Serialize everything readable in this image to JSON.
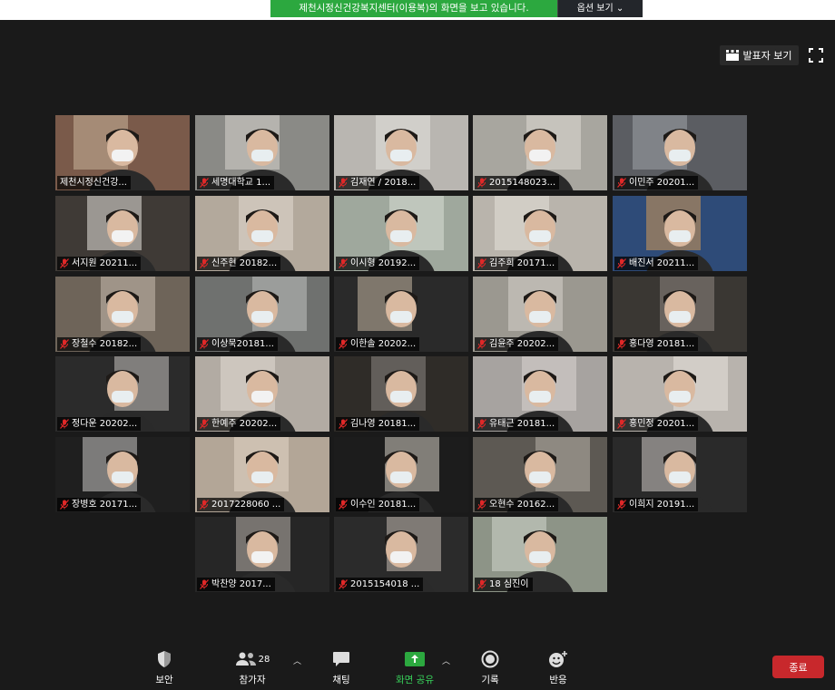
{
  "banner": {
    "sharing_text": "제천시정신건강복지센터(이용복)의 화면을 보고 있습니다.",
    "options_label": "옵션 보기"
  },
  "top_controls": {
    "speaker_view_label": "발표자 보기"
  },
  "participants": [
    {
      "name": "제천시정신건강...",
      "muted": false,
      "active": true
    },
    {
      "name": "세명대학교 1...",
      "muted": true
    },
    {
      "name": "김재연 / 2018...",
      "muted": true
    },
    {
      "name": "2015148023...",
      "muted": true
    },
    {
      "name": "이민주 20201...",
      "muted": true
    },
    {
      "name": "서지원 20211...",
      "muted": true
    },
    {
      "name": "신주현 20182...",
      "muted": true
    },
    {
      "name": "이시형 20192...",
      "muted": true
    },
    {
      "name": "김주희 20171...",
      "muted": true
    },
    {
      "name": "배진서 20211...",
      "muted": true
    },
    {
      "name": "장철수 20182...",
      "muted": true
    },
    {
      "name": "이상묵20181...",
      "muted": true
    },
    {
      "name": "이한솔 20202...",
      "muted": true
    },
    {
      "name": "김윤주 20202...",
      "muted": true
    },
    {
      "name": "홍다영 20181...",
      "muted": true
    },
    {
      "name": "정다운 20202...",
      "muted": true
    },
    {
      "name": "한예주 20202...",
      "muted": true
    },
    {
      "name": "김나영 20181...",
      "muted": true
    },
    {
      "name": "유태근 20181...",
      "muted": true
    },
    {
      "name": "홍민정 20201...",
      "muted": true
    },
    {
      "name": "장병호 20171...",
      "muted": true
    },
    {
      "name": "2017228060 ...",
      "muted": true
    },
    {
      "name": "이수인 20181...",
      "muted": true
    },
    {
      "name": "오현수 20162...",
      "muted": true
    },
    {
      "name": "이희지 20191...",
      "muted": true
    },
    {
      "name": "박찬양 2017...",
      "muted": true
    },
    {
      "name": "2015154018 ...",
      "muted": true
    },
    {
      "name": "18 심진이",
      "muted": true
    }
  ],
  "toolbar": {
    "security": "보안",
    "participants": "참가자",
    "participants_count": "28",
    "chat": "채팅",
    "share_screen": "화면 공유",
    "record": "기록",
    "reactions": "반응",
    "end": "종료"
  },
  "colors": {
    "active_speaker": "#c8e63b",
    "share_green": "#2ca83f",
    "end_red": "#c8282c",
    "muted_red": "#e02828"
  }
}
